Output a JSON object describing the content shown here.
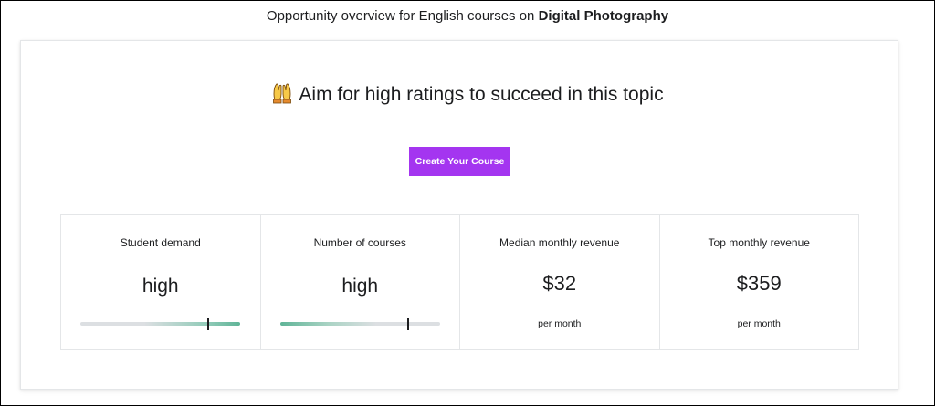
{
  "header": {
    "prefix": "Opportunity overview for English courses on ",
    "topic": "Digital Photography"
  },
  "headline": {
    "emoji_icon": "raising-hands-emoji",
    "text": "Aim for high ratings to succeed in this topic"
  },
  "cta": {
    "label": "Create Your Course",
    "color": "#a435f0"
  },
  "stats": {
    "student_demand": {
      "label": "Student demand",
      "value": "high",
      "level": 0.8
    },
    "number_of_courses": {
      "label": "Number of courses",
      "value": "high",
      "level": 0.8
    },
    "median_revenue": {
      "label": "Median monthly revenue",
      "value": "$32",
      "sub": "per month"
    },
    "top_revenue": {
      "label": "Top monthly revenue",
      "value": "$359",
      "sub": "per month"
    }
  }
}
